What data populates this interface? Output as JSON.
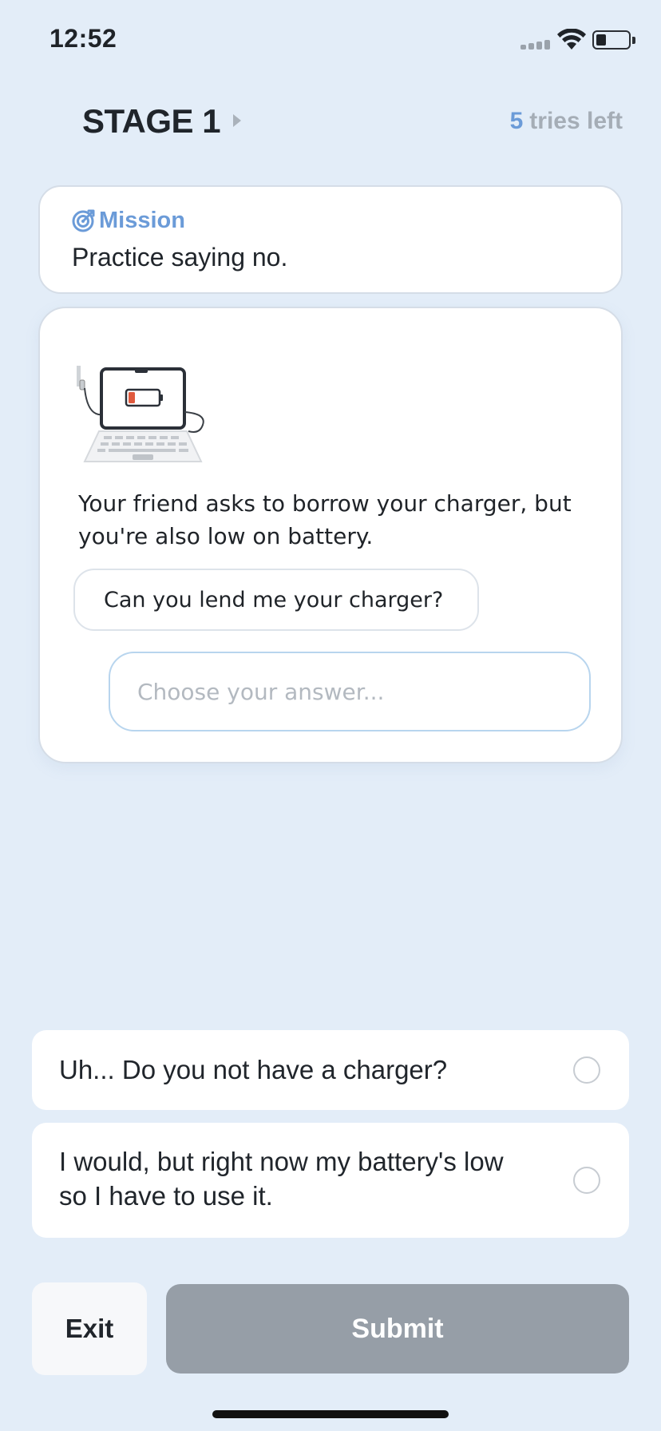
{
  "status_bar": {
    "time": "12:52"
  },
  "header": {
    "stage_title": "STAGE 1",
    "tries_count": "5",
    "tries_label": "tries left"
  },
  "mission": {
    "label": "Mission",
    "text": "Practice saying no."
  },
  "scenario": {
    "illustration": "laptop-low-battery-icon",
    "description": "Your friend asks to borrow your charger, but you're also low on battery.",
    "speech": "Can you lend me your charger?",
    "answer_placeholder": "Choose your answer..."
  },
  "options": [
    {
      "text": "Uh... Do you not have a charger?",
      "selected": false
    },
    {
      "text": "I would, but right now my battery's low so I have to use it.",
      "selected": false
    }
  ],
  "buttons": {
    "exit": "Exit",
    "submit": "Submit"
  },
  "colors": {
    "background": "#e3edf8",
    "accent": "#6b9bd8",
    "submit_disabled": "#969ea7"
  }
}
